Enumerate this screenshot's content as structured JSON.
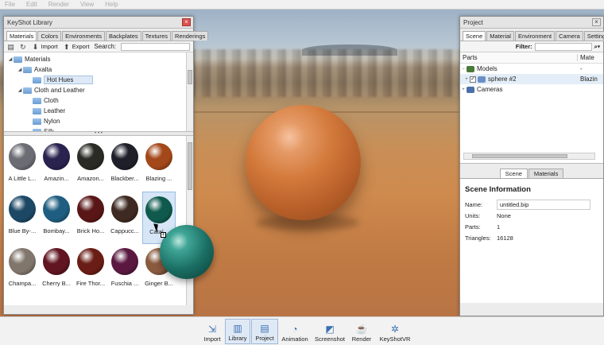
{
  "menubar": [
    "File",
    "Edit",
    "Render",
    "View",
    "Help"
  ],
  "library": {
    "title": "KeyShot Library",
    "tabs": [
      "Materials",
      "Colors",
      "Environments",
      "Backplates",
      "Textures",
      "Renderings"
    ],
    "toolbar": {
      "import": "Import",
      "export": "Export",
      "search_label": "Search:"
    },
    "tree": [
      {
        "label": "Materials",
        "level": 0
      },
      {
        "label": "Axalta",
        "level": 1
      },
      {
        "label": "Hot Hues",
        "level": 2,
        "selected": true
      },
      {
        "label": "Cloth and Leather",
        "level": 1
      },
      {
        "label": "Cloth",
        "level": 2
      },
      {
        "label": "Leather",
        "level": 2
      },
      {
        "label": "Nylon",
        "level": 2
      },
      {
        "label": "Silk",
        "level": 2
      }
    ],
    "materials": [
      {
        "label": "A Little L...",
        "color": "#6c6c74"
      },
      {
        "label": "Amazin...",
        "color": "#2a2350"
      },
      {
        "label": "Amazon...",
        "color": "#2b2b26"
      },
      {
        "label": "Blackber...",
        "color": "#1f1f2a"
      },
      {
        "label": "Blazing ...",
        "color": "#a3481a"
      },
      {
        "label": "Blue By-...",
        "color": "#1c4866"
      },
      {
        "label": "Bombay...",
        "color": "#1f5e80"
      },
      {
        "label": "Brick Ho...",
        "color": "#5a1616"
      },
      {
        "label": "Cappucc...",
        "color": "#3f2a22"
      },
      {
        "label": "Catal...",
        "color": "#0f5a4c",
        "selected": true
      },
      {
        "label": "Champa...",
        "color": "#80766c"
      },
      {
        "label": "Cherry B...",
        "color": "#601520"
      },
      {
        "label": "Fire Thor...",
        "color": "#6a1d14"
      },
      {
        "label": "Fuschia ...",
        "color": "#5a1840"
      },
      {
        "label": "Ginger B...",
        "color": "#8a5a3e"
      }
    ]
  },
  "project": {
    "title": "Project",
    "tabs": [
      "Scene",
      "Material",
      "Environment",
      "Camera",
      "Settings"
    ],
    "filter_label": "Filter:",
    "columns": {
      "parts": "Parts",
      "material": "Mate"
    },
    "rows": [
      {
        "label": "Models",
        "material": "-"
      },
      {
        "label": "sphere #2",
        "material": "Blazin"
      },
      {
        "label": "Cameras",
        "material": ""
      }
    ],
    "subtabs": [
      "Scene",
      "Materials"
    ],
    "info": {
      "heading": "Scene Information",
      "name_key": "Name:",
      "name_val": "untitled.bip",
      "units_key": "Units:",
      "units_val": "None",
      "parts_key": "Parts:",
      "parts_val": "1",
      "tri_key": "Triangles:",
      "tri_val": "16128"
    }
  },
  "ribbon": [
    "Import",
    "Library",
    "Project",
    "Animation",
    "Screenshot",
    "Render",
    "KeyShotVR"
  ],
  "ribbon_icons": [
    "import-icon",
    "library-icon",
    "project-icon",
    "animation-icon",
    "screenshot-icon",
    "render-icon",
    "keyshotvr-icon"
  ]
}
